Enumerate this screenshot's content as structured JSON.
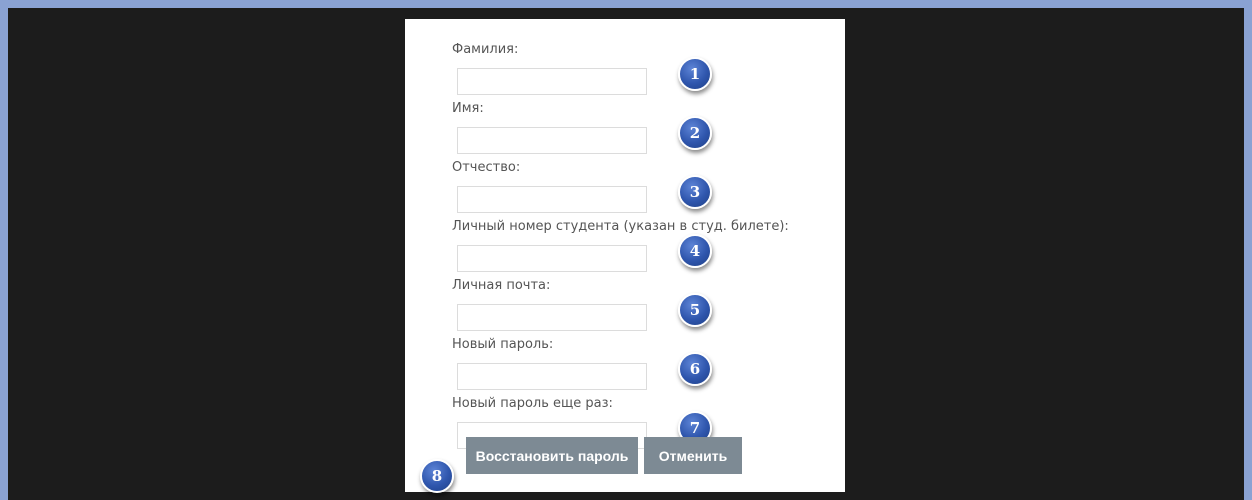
{
  "form": {
    "fields": [
      {
        "label": "Фамилия:",
        "value": "",
        "marker": "1"
      },
      {
        "label": "Имя:",
        "value": "",
        "marker": "2"
      },
      {
        "label": "Отчество:",
        "value": "",
        "marker": "3"
      },
      {
        "label": "Личный номер студента (указан в студ. билете):",
        "value": "",
        "marker": "4"
      },
      {
        "label": "Личная почта:",
        "value": "",
        "marker": "5"
      },
      {
        "label": "Новый пароль:",
        "value": "",
        "marker": "6"
      },
      {
        "label": "Новый пароль еще раз:",
        "value": "",
        "marker": "7"
      }
    ],
    "restore_button": {
      "label": "Восстановить пароль",
      "marker": "8"
    },
    "cancel_button": {
      "label": "Отменить"
    }
  },
  "colors": {
    "outer_border": "#8aa2d3",
    "background": "#1c1c1c",
    "panel": "#ffffff",
    "button": "#7d8a94",
    "marker": "#2f56ad"
  }
}
